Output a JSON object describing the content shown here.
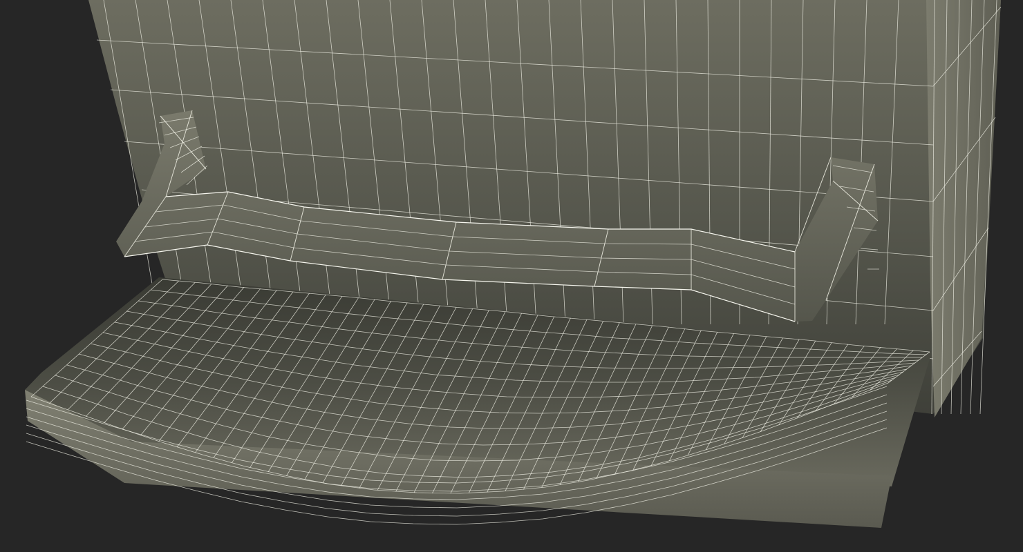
{
  "scene": {
    "subject": "wireframe-3d-model",
    "colors": {
      "background": "#262626",
      "surface_light": "#7a7a6c",
      "surface_mid": "#5c5c52",
      "surface_dark": "#34352e",
      "wire": "#f2f2e6"
    }
  }
}
